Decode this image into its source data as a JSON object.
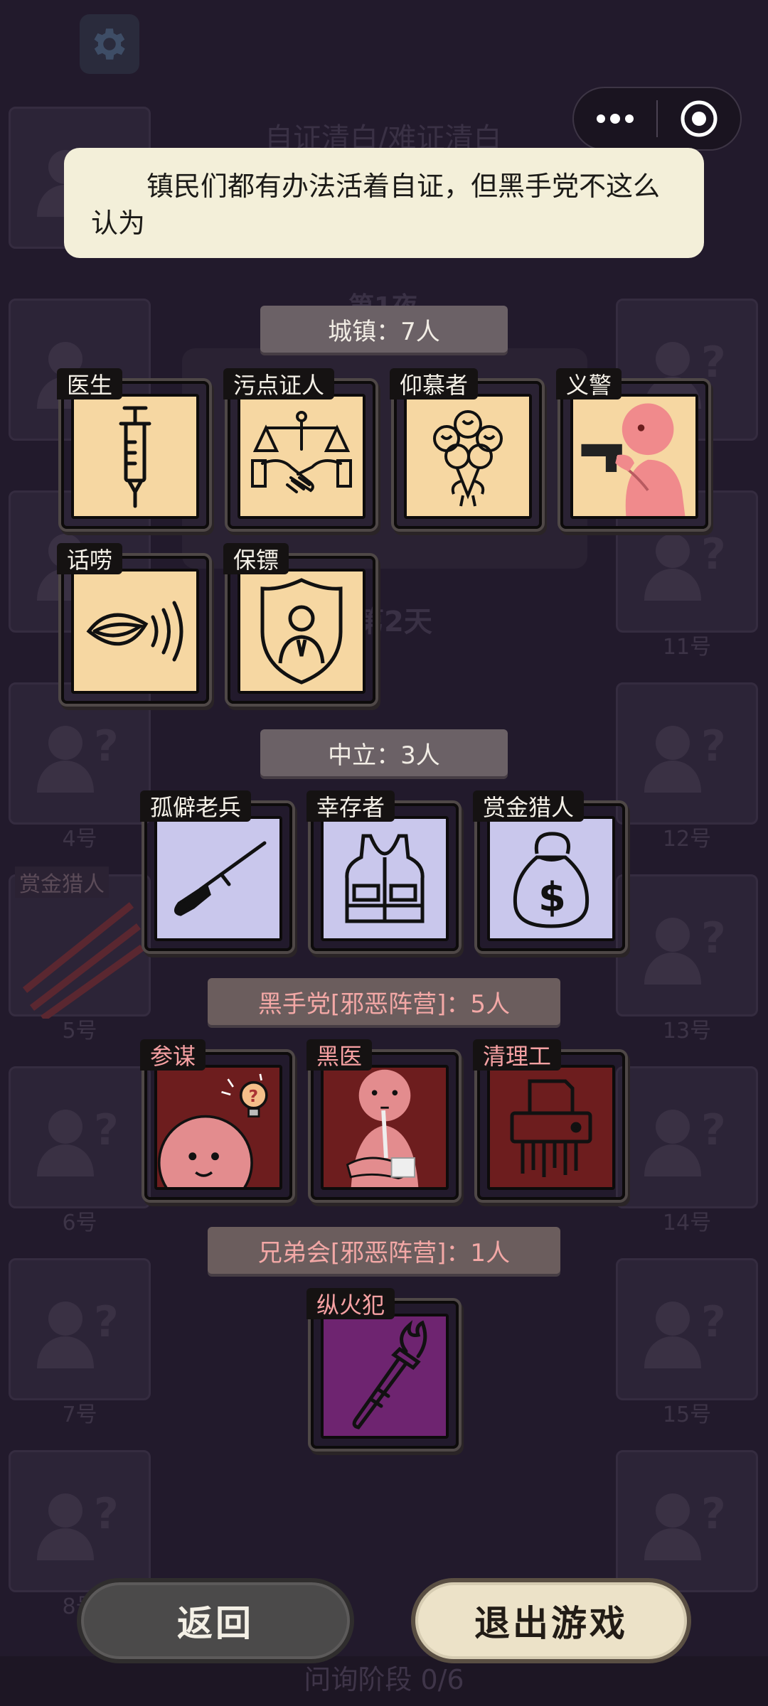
{
  "background": {
    "title": "自证清白/难证清白",
    "night_label": "第1夜",
    "day_label": "第2天",
    "phase_text": "问询阶段 0/6",
    "dead_role_tag": "赏金猎人",
    "players": {
      "p4": "4号",
      "p5": "5号",
      "p6": "6号",
      "p7": "7号",
      "p8": "8号",
      "p11": "11号",
      "p12": "12号",
      "p13": "13号",
      "p14": "14号",
      "p15": "15号"
    }
  },
  "tooltip": {
    "text": "镇民们都有办法活着自证，但黑手党不这么认为"
  },
  "sections": {
    "town": "城镇：7人",
    "neutral": "中立：3人",
    "mafia": "黑手党[邪恶阵营]：5人",
    "brotherhood": "兄弟会[邪恶阵营]：1人"
  },
  "roles": {
    "doctor": "医生",
    "tainted_witness": "污点证人",
    "admirer": "仰慕者",
    "vigilante": "义警",
    "chatterbox": "话唠",
    "bodyguard": "保镖",
    "veteran": "孤僻老兵",
    "survivor": "幸存者",
    "bounty_hunter": "赏金猎人",
    "strategist": "参谋",
    "black_doctor": "黑医",
    "janitor": "清理工",
    "arsonist": "纵火犯"
  },
  "buttons": {
    "back": "返回",
    "exit": "退出游戏"
  },
  "colors": {
    "town_card": "#f6d7a2",
    "neutral_card": "#c9c7ec",
    "mafia_card": "#6d1d1e",
    "brotherhood_card": "#6e2470",
    "evil_text": "#f3a8a6"
  }
}
